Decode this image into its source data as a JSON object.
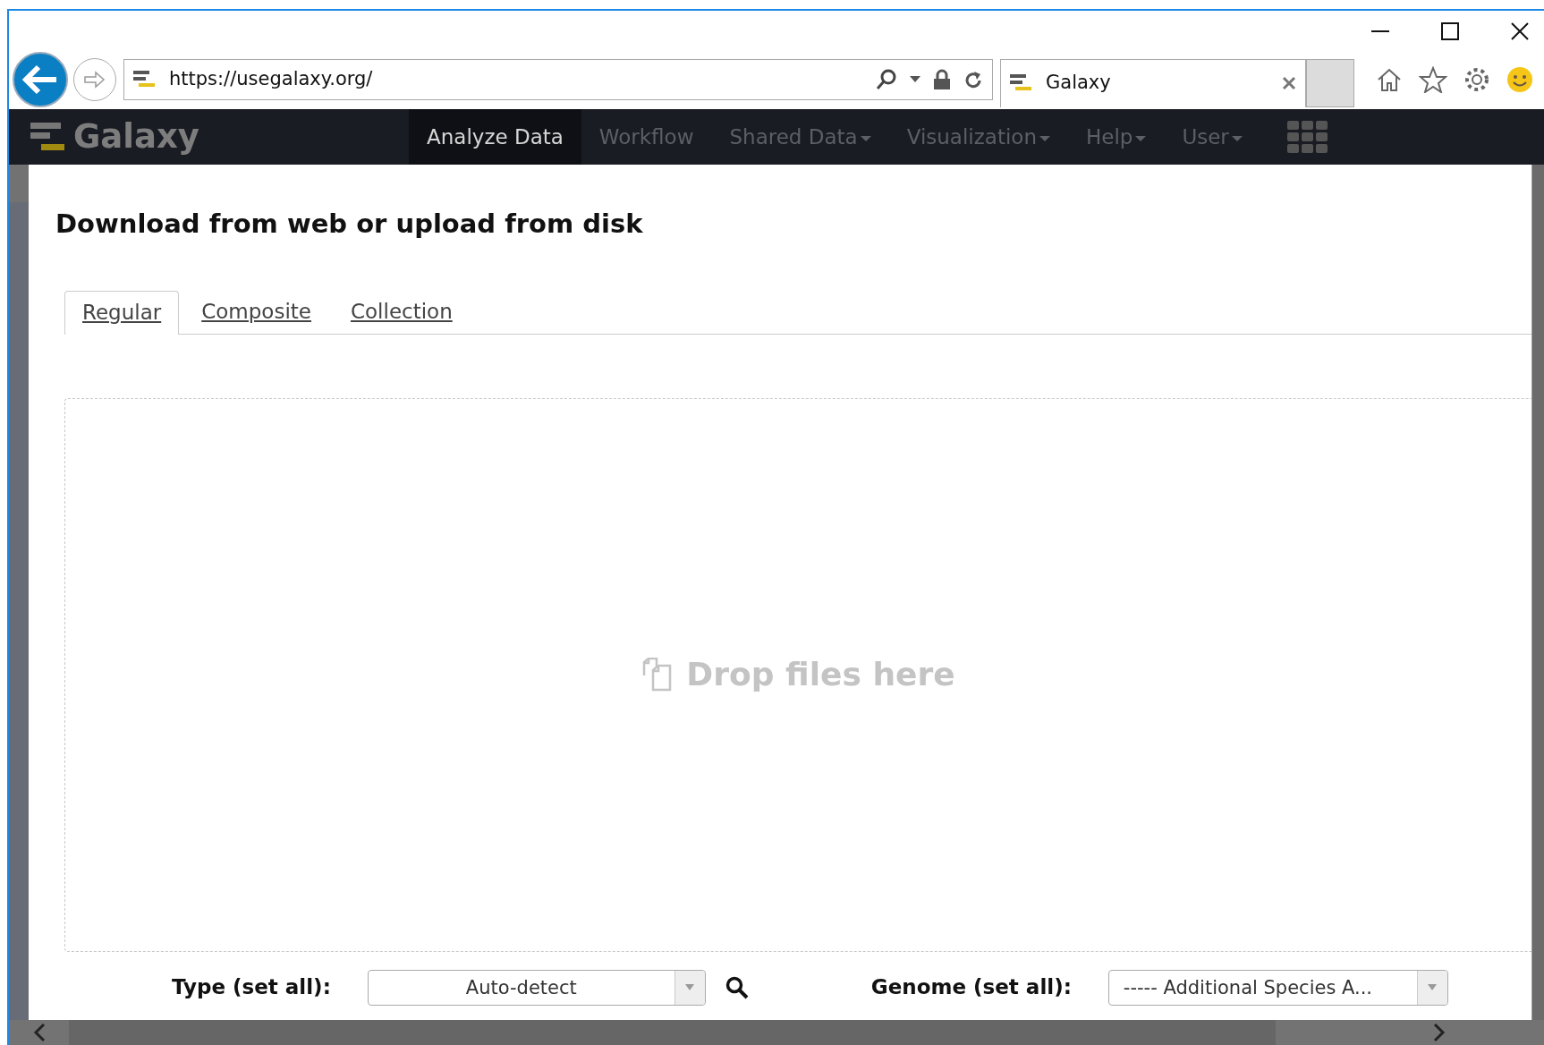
{
  "browser": {
    "address": "https://usegalaxy.org/",
    "tab_title": "Galaxy"
  },
  "navbar": {
    "brand": "Galaxy",
    "items": [
      {
        "label": "Analyze Data",
        "selected": true,
        "dropdown": false
      },
      {
        "label": "Workflow",
        "selected": false,
        "dropdown": false
      },
      {
        "label": "Shared Data",
        "selected": false,
        "dropdown": true
      },
      {
        "label": "Visualization",
        "selected": false,
        "dropdown": true
      },
      {
        "label": "Help",
        "selected": false,
        "dropdown": true
      },
      {
        "label": "User",
        "selected": false,
        "dropdown": true
      }
    ]
  },
  "dialog": {
    "title": "Download from web or upload from disk",
    "tabs": [
      {
        "label": "Regular",
        "selected": true
      },
      {
        "label": "Composite",
        "selected": false
      },
      {
        "label": "Collection",
        "selected": false
      }
    ],
    "dropzone": "Drop files here",
    "type": {
      "label": "Type (set all):",
      "value": "Auto-detect"
    },
    "genome": {
      "label": "Genome (set all):",
      "value": "----- Additional Species A..."
    }
  }
}
